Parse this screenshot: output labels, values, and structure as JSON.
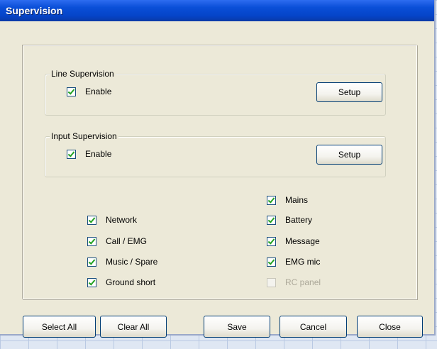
{
  "window": {
    "title": "Supervision"
  },
  "line_supervision": {
    "legend": "Line Supervision",
    "enable_label": "Enable",
    "enable_checked": true,
    "setup_label": "Setup"
  },
  "input_supervision": {
    "legend": "Input Supervision",
    "enable_label": "Enable",
    "enable_checked": true,
    "setup_label": "Setup"
  },
  "left_checks": [
    {
      "label": "Network",
      "checked": true
    },
    {
      "label": "Call / EMG",
      "checked": true
    },
    {
      "label": "Music / Spare",
      "checked": true
    },
    {
      "label": "Ground short",
      "checked": true
    }
  ],
  "right_checks": [
    {
      "label": "Mains",
      "checked": true
    },
    {
      "label": "Battery",
      "checked": true
    },
    {
      "label": "Message",
      "checked": true
    },
    {
      "label": "EMG mic",
      "checked": true
    },
    {
      "label": "RC panel",
      "checked": false,
      "disabled": true
    }
  ],
  "buttons": {
    "select_all": "Select All",
    "clear_all": "Clear All",
    "save": "Save",
    "cancel": "Cancel",
    "close": "Close"
  }
}
